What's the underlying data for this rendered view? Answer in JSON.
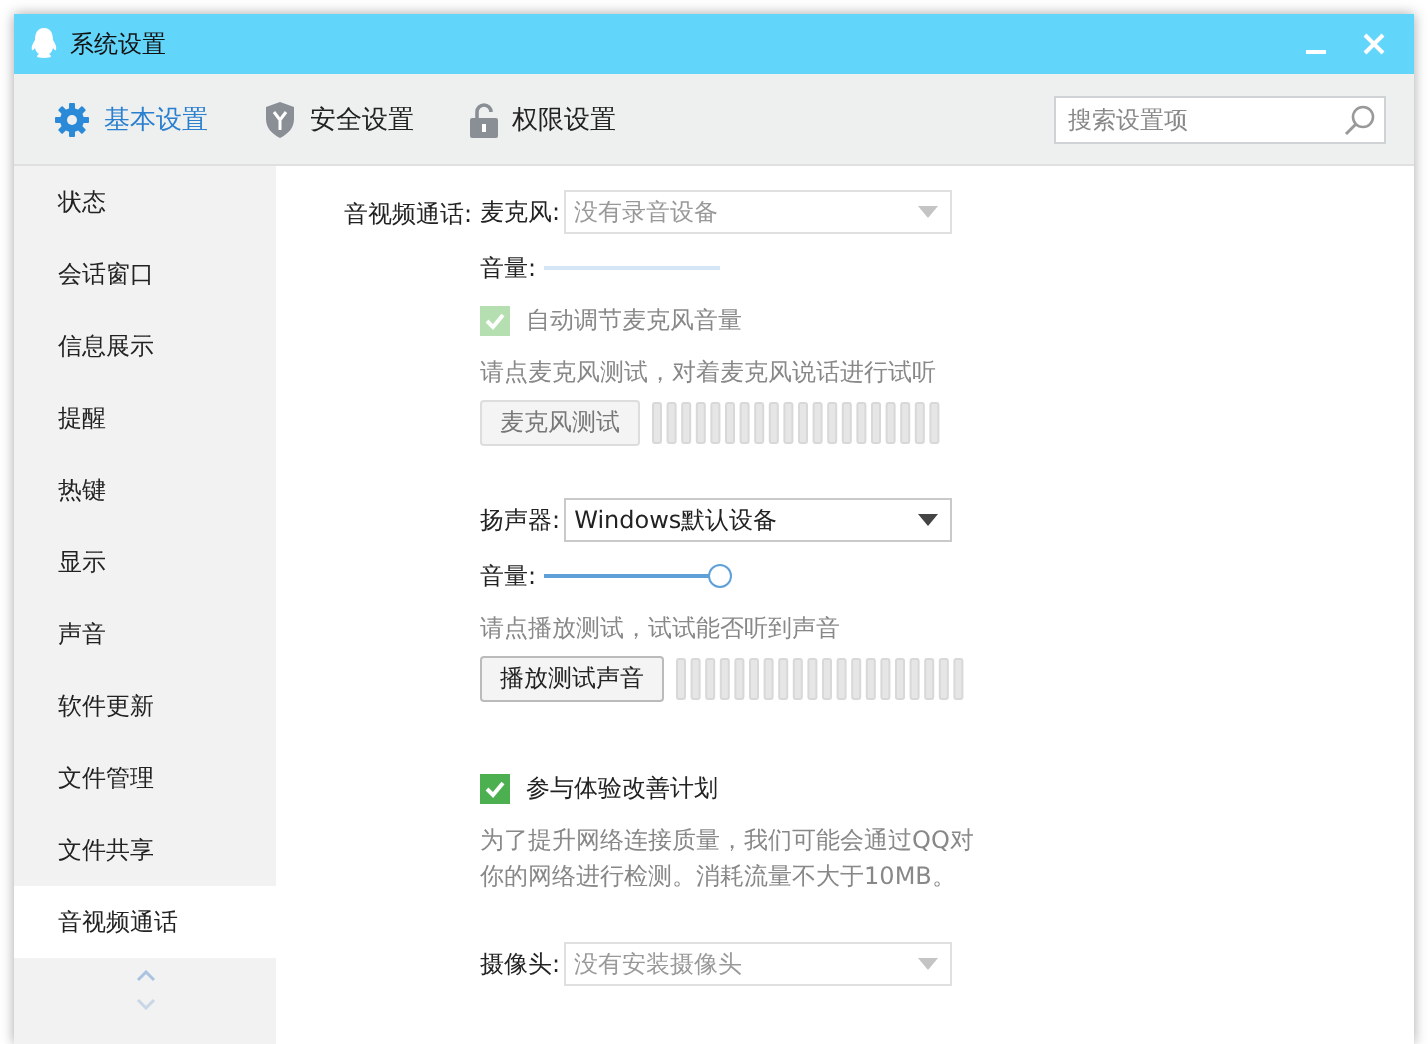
{
  "window": {
    "title": "系统设置"
  },
  "tabs": [
    {
      "label": "基本设置",
      "kind": "gear",
      "selected": true
    },
    {
      "label": "安全设置",
      "kind": "shield",
      "selected": false
    },
    {
      "label": "权限设置",
      "kind": "lock",
      "selected": false
    }
  ],
  "search": {
    "placeholder": "搜索设置项"
  },
  "sidebar": {
    "items": [
      {
        "label": "状态",
        "selected": false
      },
      {
        "label": "会话窗口",
        "selected": false
      },
      {
        "label": "信息展示",
        "selected": false
      },
      {
        "label": "提醒",
        "selected": false
      },
      {
        "label": "热键",
        "selected": false
      },
      {
        "label": "显示",
        "selected": false
      },
      {
        "label": "声音",
        "selected": false
      },
      {
        "label": "软件更新",
        "selected": false
      },
      {
        "label": "文件管理",
        "selected": false
      },
      {
        "label": "文件共享",
        "selected": false
      },
      {
        "label": "音视频通话",
        "selected": true
      }
    ]
  },
  "content": {
    "section_label": "音视频通话:",
    "microphone": {
      "label": "麦克风:",
      "value": "没有录音设备",
      "disabled": true
    },
    "mic_volume": {
      "label": "音量:",
      "level": 0,
      "disabled": true
    },
    "auto_adjust": {
      "label": "自动调节麦克风音量",
      "checked": true,
      "disabled": true
    },
    "mic_hint": "请点麦克风测试，对着麦克风说话进行试听",
    "mic_test_button": {
      "label": "麦克风测试",
      "disabled": true
    },
    "speaker": {
      "label": "扬声器:",
      "value": "Windows默认设备",
      "disabled": false
    },
    "speaker_volume": {
      "label": "音量:",
      "level": 1,
      "disabled": false
    },
    "speaker_hint": "请点播放测试，试试能否听到声音",
    "speaker_test_button": {
      "label": "播放测试声音",
      "disabled": false
    },
    "experience": {
      "label": "参与体验改善计划",
      "checked": true,
      "disabled": false
    },
    "experience_note": "为了提升网络连接质量，我们可能会通过QQ对你的网络进行检测。消耗流量不大于10MB。",
    "camera": {
      "label": "摄像头:",
      "value": "没有安装摄像头",
      "disabled": true
    }
  }
}
